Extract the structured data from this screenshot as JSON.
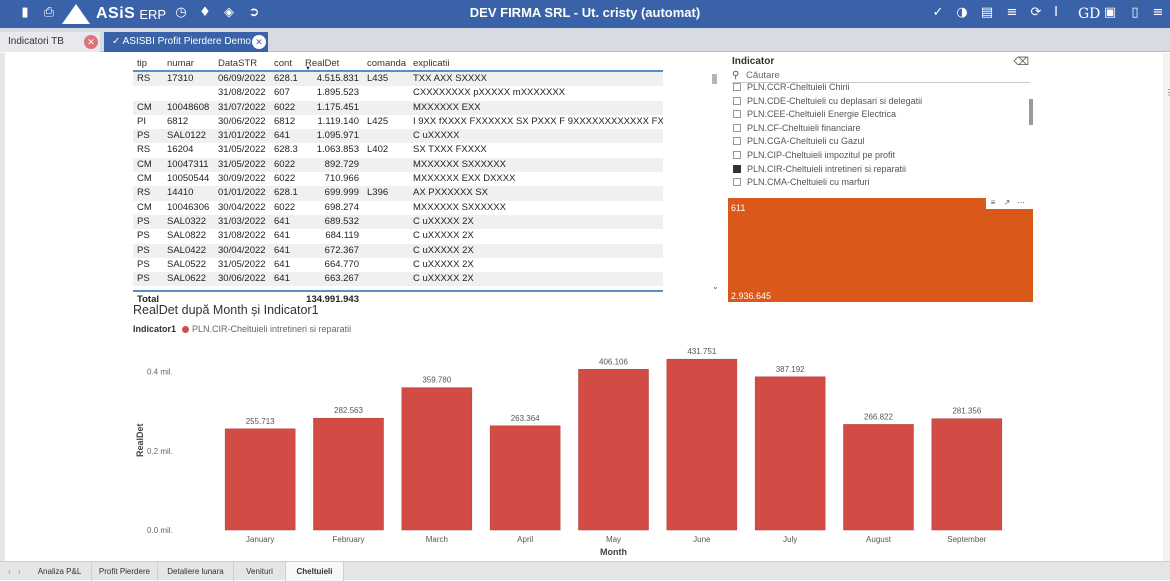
{
  "app": {
    "logo_text": "ASiS",
    "logo_suffix": "ERP",
    "title": "DEV FIRMA SRL - Ut. cristy (automat)",
    "user": "GD"
  },
  "toolbar_icons": [
    "file-icon",
    "print-icon",
    "logo-icon",
    "dashboard-icon",
    "bell-icon",
    "paint-bucket-icon",
    "exit-icon"
  ],
  "right_icons": [
    "check-icon",
    "pie-icon",
    "book-icon",
    "list-icon",
    "refresh-icon",
    "cursor-icon",
    "user-initials",
    "truck-icon",
    "phone-icon",
    "menu-icon"
  ],
  "tabs": [
    {
      "label": "Indicatori TB"
    },
    {
      "label": "ASISBI Profit Pierdere Demo"
    }
  ],
  "table": {
    "headers": {
      "tip": "tip",
      "numar": "numar",
      "datastr": "DataSTR",
      "cont": "cont",
      "realdet": "RealDet",
      "comanda": "comanda",
      "explicatii": "explicatii"
    },
    "rows": [
      {
        "tip": "RS",
        "numar": "17310",
        "datastr": "06/09/2022",
        "cont": "628.1",
        "realdet": "4.515.831",
        "comanda": "L435",
        "explicatii": "TXX AXX SXXXX"
      },
      {
        "tip": "",
        "numar": "",
        "datastr": "31/08/2022",
        "cont": "607",
        "realdet": "1.895.523",
        "comanda": "",
        "explicatii": "CXXXXXXXX pXXXXX mXXXXXXX"
      },
      {
        "tip": "CM",
        "numar": "10048608",
        "datastr": "31/07/2022",
        "cont": "6022",
        "realdet": "1.175.451",
        "comanda": "",
        "explicatii": "MXXXXXX EXX"
      },
      {
        "tip": "PI",
        "numar": "6812",
        "datastr": "30/06/2022",
        "cont": "6812",
        "realdet": "1.119.140",
        "comanda": "L425",
        "explicatii": "I 9XX fXXXX FXXXXXX SX PXXX F 9XXXXXXXXXXXX FXXXXXXX"
      },
      {
        "tip": "PS",
        "numar": "SAL0122",
        "datastr": "31/01/2022",
        "cont": "641",
        "realdet": "1.095.971",
        "comanda": "",
        "explicatii": "C uXXXXX"
      },
      {
        "tip": "RS",
        "numar": "16204",
        "datastr": "31/05/2022",
        "cont": "628.3",
        "realdet": "1.063.853",
        "comanda": "L402",
        "explicatii": "SX TXXX FXXXX"
      },
      {
        "tip": "CM",
        "numar": "10047311",
        "datastr": "31/05/2022",
        "cont": "6022",
        "realdet": "892.729",
        "comanda": "",
        "explicatii": "MXXXXXX SXXXXXX"
      },
      {
        "tip": "CM",
        "numar": "10050544",
        "datastr": "30/09/2022",
        "cont": "6022",
        "realdet": "710.966",
        "comanda": "",
        "explicatii": "MXXXXXX EXX DXXXX"
      },
      {
        "tip": "RS",
        "numar": "14410",
        "datastr": "01/01/2022",
        "cont": "628.1",
        "realdet": "699.999",
        "comanda": "L396",
        "explicatii": "AX PXXXXXX SX"
      },
      {
        "tip": "CM",
        "numar": "10046306",
        "datastr": "30/04/2022",
        "cont": "6022",
        "realdet": "698.274",
        "comanda": "",
        "explicatii": "MXXXXXX SXXXXXX"
      },
      {
        "tip": "PS",
        "numar": "SAL0322",
        "datastr": "31/03/2022",
        "cont": "641",
        "realdet": "689.532",
        "comanda": "",
        "explicatii": "C uXXXXX 2X"
      },
      {
        "tip": "PS",
        "numar": "SAL0822",
        "datastr": "31/08/2022",
        "cont": "641",
        "realdet": "684.119",
        "comanda": "",
        "explicatii": "C uXXXXX 2X"
      },
      {
        "tip": "PS",
        "numar": "SAL0422",
        "datastr": "30/04/2022",
        "cont": "641",
        "realdet": "672.367",
        "comanda": "",
        "explicatii": "C uXXXXX 2X"
      },
      {
        "tip": "PS",
        "numar": "SAL0522",
        "datastr": "31/05/2022",
        "cont": "641",
        "realdet": "664.770",
        "comanda": "",
        "explicatii": "C uXXXXX 2X"
      },
      {
        "tip": "PS",
        "numar": "SAL0622",
        "datastr": "30/06/2022",
        "cont": "641",
        "realdet": "663.267",
        "comanda": "",
        "explicatii": "C uXXXXX 2X"
      }
    ],
    "total_label": "Total",
    "total_value": "134.991.943"
  },
  "slicer": {
    "title": "Indicator",
    "search_placeholder": "Căutare",
    "items": [
      {
        "label": "PLN.CCR-Cheltuieli Chirii",
        "checked": false
      },
      {
        "label": "PLN.CDE-Cheltuieli cu deplasari si delegatii",
        "checked": false
      },
      {
        "label": "PLN.CEE-Cheltuieli Energie Electrica",
        "checked": false
      },
      {
        "label": "PLN.CF-Cheltuieli financiare",
        "checked": false
      },
      {
        "label": "PLN.CGA-Cheltuieli cu Gazul",
        "checked": false
      },
      {
        "label": "PLN.CIP-Cheltuieli impozitul pe profit",
        "checked": false
      },
      {
        "label": "PLN.CIR-Cheltuieli intretineri si reparatii",
        "checked": true
      },
      {
        "label": "PLN.CMA-Cheltuieli cu marfuri",
        "checked": false
      }
    ]
  },
  "card": {
    "top_value": "611",
    "bottom_value": "2.936.645",
    "color": "#d9581a"
  },
  "chart_data": {
    "type": "bar",
    "title": "RealDet după Month și Indicator1",
    "legend_title": "Indicator1",
    "xlabel": "Month",
    "ylabel": "RealDet",
    "categories": [
      "January",
      "February",
      "March",
      "April",
      "May",
      "June",
      "July",
      "August",
      "September"
    ],
    "series": [
      {
        "name": "PLN.CIR-Cheltuieli intretineri si reparatii",
        "color": "#d24b45",
        "values": [
          255713,
          282563,
          359780,
          263364,
          406106,
          431751,
          387192,
          266822,
          281356
        ]
      }
    ],
    "data_labels": [
      "255.713",
      "282.563",
      "359.780",
      "263.364",
      "406.106",
      "431.751",
      "387.192",
      "266.822",
      "281.356"
    ],
    "y_ticks": [
      {
        "value": 0,
        "label": "0.0 mil."
      },
      {
        "value": 200000,
        "label": "0.2 mil."
      },
      {
        "value": 400000,
        "label": "0.4 mil."
      }
    ],
    "ylim": [
      0,
      460000
    ],
    "grid": false,
    "legend_position": "top-left"
  },
  "bottom_tabs": [
    {
      "label": "Analiza P&L",
      "active": false
    },
    {
      "label": "Profit Pierdere",
      "active": false
    },
    {
      "label": "Detaliere lunara",
      "active": false
    },
    {
      "label": "Venituri",
      "active": false
    },
    {
      "label": "Cheltuieli",
      "active": true
    }
  ]
}
